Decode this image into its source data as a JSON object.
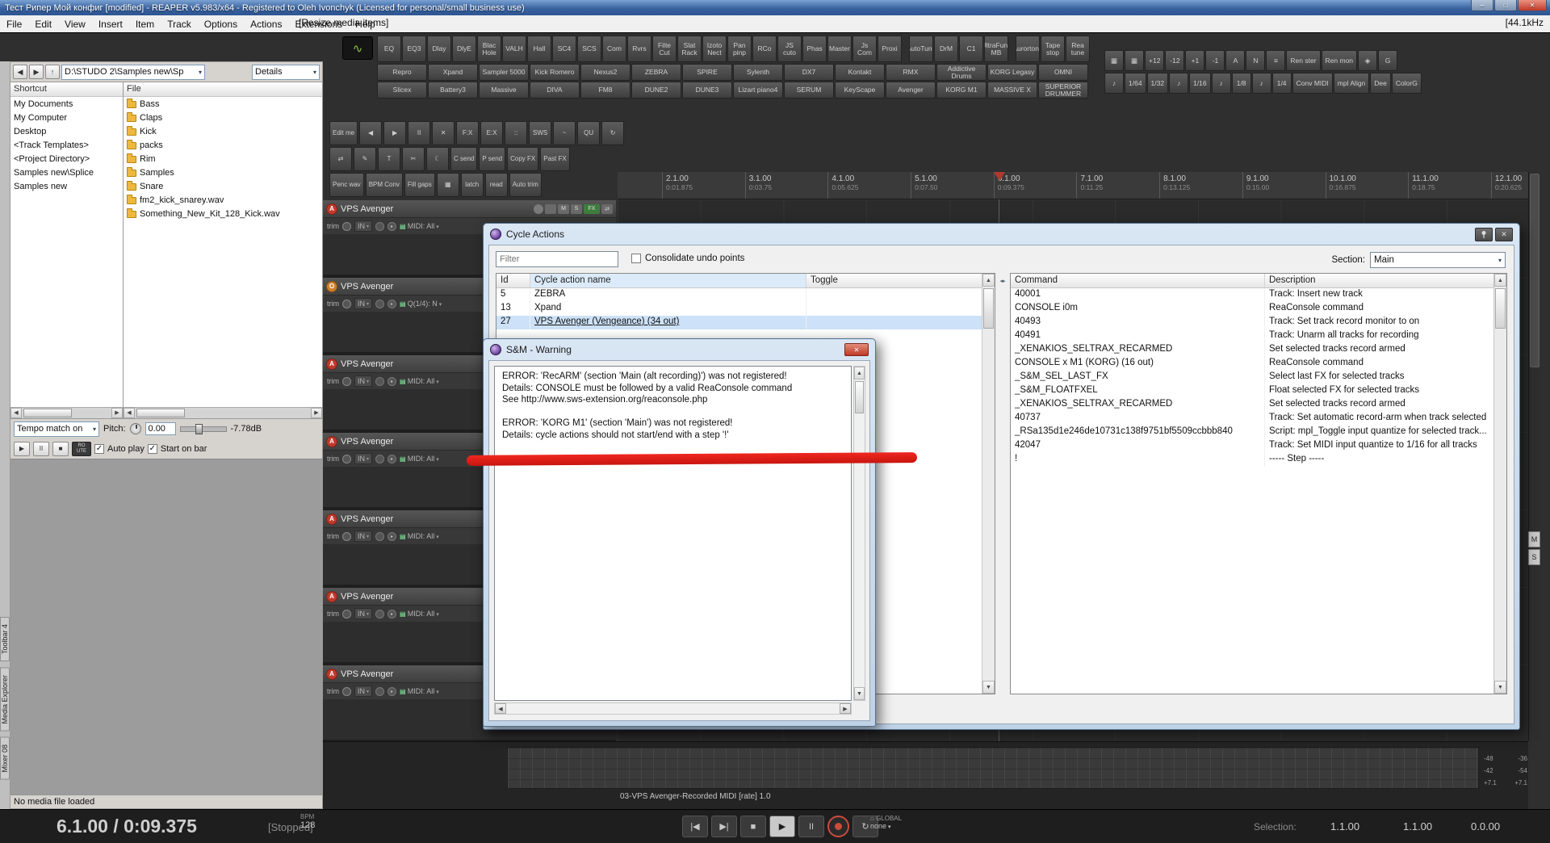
{
  "titlebar": {
    "title": "Тест Рипер Мой конфиг [modified] - REAPER v5.983/x64 - Registered to Oleh Ivonchyk (Licensed for personal/small business use)"
  },
  "menubar": {
    "items": [
      "File",
      "Edit",
      "View",
      "Insert",
      "Item",
      "Track",
      "Options",
      "Actions",
      "Extensions",
      "Help"
    ],
    "status": "[Resize media items]",
    "right": "[44.1kHz"
  },
  "toolbars": {
    "fx_row": [
      "EQ",
      "EQ3",
      "Dlay",
      "DlyE",
      "Blac Hole",
      "VALH",
      "Hall",
      "SC4",
      "SCS",
      "Com",
      "Rvrs",
      "Filte Cut",
      "Slat Rack",
      "Izoto Nect",
      "Pan pinp",
      "RCo",
      "JS cuto",
      "Phas",
      "Master",
      "Js Com",
      "Proxi"
    ],
    "fx_row2": [
      "AutoTune",
      "DrM",
      "C1",
      "UltraFunk MB"
    ],
    "fx_row3": [
      "Aurortone",
      "Tape stop",
      "Rea tune"
    ],
    "inst_row1": [
      "Repro",
      "Xpand",
      "Sampler 5000",
      "Kick Romero",
      "Nexus2",
      "ZEBRA",
      "SPIRE",
      "Sylenth",
      "DX7",
      "Kontakt",
      "RMX",
      "Addictive Drums",
      "KORG Legasy",
      "OMNI"
    ],
    "inst_row2": [
      "Slicex",
      "Battery3",
      "Massive",
      "DIVA",
      "FM8",
      "DUNE2",
      "DUNE3",
      "Lizart piano4",
      "SERUM",
      "KeyScape",
      "Avenger",
      "KORG M1",
      "MASSIVE X",
      "SUPERIOR DRUMMER"
    ],
    "right_row1": [
      "▦",
      "▦",
      "+12",
      "-12",
      "+1",
      "-1",
      "A",
      "N",
      "≡",
      "Ren ster",
      "Ren mon",
      "◈",
      "G"
    ],
    "right_row2": [
      "♪",
      "1/64",
      "1/32",
      "♪",
      "1/16",
      "♪",
      "1/8",
      "♪",
      "1/4",
      "Conv MIDI",
      "mpl Align",
      "Dee",
      "ColorG"
    ]
  },
  "track_toolbar": {
    "row1": [
      "Edit me",
      "◀",
      "▶",
      "II",
      "✕",
      "F:X",
      "E:X",
      "::",
      "SWS",
      "~",
      "QU",
      "↻"
    ],
    "row2": [
      "⇄",
      "✎",
      "T",
      "✂",
      "☾",
      "C send",
      "P send",
      "Copy FX",
      "Past FX"
    ],
    "row3": [
      "Penc wav",
      "BPM Conv",
      "Fill gaps",
      "▦",
      "latch",
      "read",
      "Auto trim"
    ]
  },
  "left_tabs": [
    "Toolbar 4",
    "Media Explorer",
    "Mixer 08"
  ],
  "media_explorer": {
    "path": "D:\\STUDO 2\\Samples new\\Sp",
    "details_label": "Details",
    "shortcut_header": "Shortcut",
    "file_header": "File",
    "shortcuts": [
      "My Documents",
      "My Computer",
      "Desktop",
      "<Track Templates>",
      "<Project Directory>",
      "Samples new\\Splice",
      "Samples new"
    ],
    "files": [
      {
        "name": "Bass",
        "type": "folder"
      },
      {
        "name": "Claps",
        "type": "folder"
      },
      {
        "name": "Kick",
        "type": "folder"
      },
      {
        "name": "packs",
        "type": "folder"
      },
      {
        "name": "Rim",
        "type": "folder"
      },
      {
        "name": "Samples",
        "type": "folder"
      },
      {
        "name": "Snare",
        "type": "folder"
      },
      {
        "name": "fm2_kick_snarey.wav",
        "type": "wav"
      },
      {
        "name": "Something_New_Kit_128_Kick.wav",
        "type": "wav"
      }
    ],
    "tempo_match": "Tempo match on",
    "pitch_label": "Pitch:",
    "pitch_value": "0.00",
    "volume_db": "-7.78dB",
    "route_label": "RO UTE",
    "autoplay_label": "Auto play",
    "startonbar_label": "Start on bar",
    "status": "No media file loaded"
  },
  "track_strip": {
    "trim": "trim",
    "in": "IN",
    "mute": "M",
    "solo": "S",
    "fx": "FX",
    "route": "⇄"
  },
  "tracks": [
    {
      "arm": "A",
      "armcls": "red",
      "name": "VPS Avenger",
      "midi": "MIDI: All"
    },
    {
      "arm": "O",
      "armcls": "orange",
      "name": "VPS Avenger",
      "midi": "Q(1/4): N"
    },
    {
      "arm": "A",
      "armcls": "red",
      "name": "VPS Avenger",
      "midi": "MIDI: All"
    },
    {
      "arm": "A",
      "armcls": "red",
      "name": "VPS Avenger",
      "midi": "MIDI: All"
    },
    {
      "arm": "A",
      "armcls": "red",
      "name": "VPS Avenger",
      "midi": "MIDI: All"
    },
    {
      "arm": "A",
      "armcls": "red",
      "name": "VPS Avenger",
      "midi": "MIDI: All"
    },
    {
      "arm": "A",
      "armcls": "red",
      "name": "VPS Avenger",
      "midi": "MIDI: All"
    }
  ],
  "ruler": [
    {
      "bar": "2.1.00",
      "time": "0:01.875"
    },
    {
      "bar": "3.1.00",
      "time": "0:03.75"
    },
    {
      "bar": "4.1.00",
      "time": "0:05.625"
    },
    {
      "bar": "5.1.00",
      "time": "0:07.50"
    },
    {
      "bar": "6.1.00",
      "time": "0:09.375"
    },
    {
      "bar": "7.1.00",
      "time": "0:11.25"
    },
    {
      "bar": "8.1.00",
      "time": "0:13.125"
    },
    {
      "bar": "9.1.00",
      "time": "0:15.00"
    },
    {
      "bar": "10.1.00",
      "time": "0:16.875"
    },
    {
      "bar": "11.1.00",
      "time": "0:18.75"
    },
    {
      "bar": "12.1.00",
      "time": "0:20.625"
    }
  ],
  "cycle_dialog": {
    "title": "Cycle Actions",
    "filter_placeholder": "Filter",
    "consolidate_label": "Consolidate undo points",
    "section_label": "Section:",
    "section_value": "Main",
    "left_table": {
      "headers": [
        "Id",
        "Cycle action name",
        "Toggle"
      ],
      "rows": [
        {
          "id": "5",
          "name": "ZEBRA",
          "cls": ""
        },
        {
          "id": "13",
          "name": "Xpand",
          "cls": ""
        },
        {
          "id": "27",
          "name": "VPS Avenger (Vengeance) (34 out)",
          "cls": "sel"
        }
      ]
    },
    "right_table": {
      "headers": [
        "Command",
        "Description"
      ],
      "rows": [
        [
          "40001",
          "Track: Insert new track"
        ],
        [
          "CONSOLE i0m",
          "ReaConsole command"
        ],
        [
          "40493",
          "Track: Set track record monitor to on"
        ],
        [
          "40491",
          "Track: Unarm all tracks for recording"
        ],
        [
          "_XENAKIOS_SELTRAX_RECARMED",
          "Set selected tracks record armed"
        ],
        [
          "CONSOLE x M1 (KORG) (16 out)",
          "ReaConsole command"
        ],
        [
          "_S&M_SEL_LAST_FX",
          "Select last FX for selected tracks"
        ],
        [
          "_S&M_FLOATFXEL",
          "Float selected FX for selected tracks"
        ],
        [
          "_XENAKIOS_SELTRAX_RECARMED",
          "Set selected tracks record armed"
        ],
        [
          "40737",
          "Track: Set automatic record-arm when track selected"
        ],
        [
          "_RSa135d1e246de10731c138f9751bf5509ccbbb840",
          "Script: mpl_Toggle input quantize for selected track..."
        ],
        [
          "42047",
          "Track: Set MIDI input quantize to 1/16 for all tracks"
        ],
        [
          "!",
          "----- Step -----"
        ]
      ]
    }
  },
  "warning_dialog": {
    "title": "S&M - Warning",
    "lines": [
      "ERROR: 'RecARM' (section 'Main (alt recording)') was not registered!",
      "Details: CONSOLE must be followed by a valid ReaConsole command",
      "See http://www.sws-extension.org/reaconsole.php",
      "",
      "ERROR: 'KORG M1' (section 'Main') was not registered!",
      "Details: cycle actions should not start/end with a step '!'"
    ]
  },
  "transport": {
    "item_status": "03-VPS Avenger-Recorded MIDI [rate] 1.0",
    "time": "6.1.00 / 0:09.375",
    "state": "[Stopped]",
    "bpm_label": "BPM",
    "bpm_value": "128",
    "icons": {
      "prev": "|◀",
      "next": "▶|",
      "stop": "■",
      "play": "▶",
      "pause": "II",
      "loop": "↻",
      "home": "⌂ ",
      "back": "◀",
      "fwd": "▶",
      "up": "↑"
    },
    "global_label": "GLOBAL",
    "global_value": "none",
    "selection_label": "Selection:",
    "sel_start": "1.1.00",
    "sel_end": "1.1.00",
    "sel_len": "0.0.00"
  },
  "meters": {
    "rows": [
      [
        "-48",
        "-36"
      ],
      [
        "-42",
        "-54"
      ],
      [
        "+7.1",
        "+7.1"
      ]
    ]
  },
  "watermark": "S&M",
  "colors": {
    "annotation_red": "#e3201b",
    "record_red": "#c0392b"
  }
}
